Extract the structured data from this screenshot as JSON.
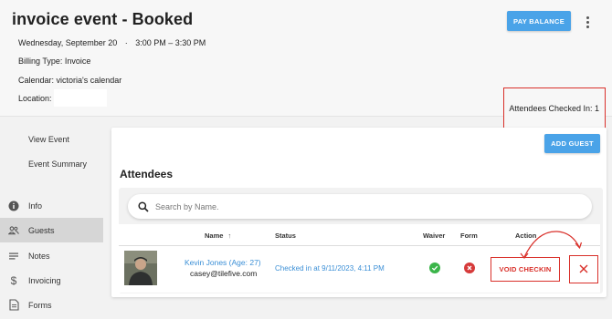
{
  "header": {
    "title": "invoice event - Booked",
    "date": "Wednesday, September 20",
    "separator": "·",
    "time": "3:00 PM – 3:30 PM",
    "billing": "Billing Type: Invoice",
    "calendar": "Calendar: victoria's calendar",
    "location": "Location:",
    "pay_balance": "PAY BALANCE",
    "checked_in": "Attendees Checked In: 1"
  },
  "sidebar": {
    "items": [
      {
        "label": "View Event"
      },
      {
        "label": "Event Summary"
      },
      {
        "label": "Info",
        "icon": "info-icon"
      },
      {
        "label": "Guests",
        "icon": "people-icon",
        "active": true
      },
      {
        "label": "Notes",
        "icon": "notes-icon"
      },
      {
        "label": "Invoicing",
        "icon": "dollar-icon"
      },
      {
        "label": "Forms",
        "icon": "document-icon"
      }
    ]
  },
  "main": {
    "add_guest": "ADD GUEST",
    "attendees_heading": "Attendees",
    "search_placeholder": "Search by Name.",
    "columns": {
      "name": "Name",
      "sort_arrow": "↑",
      "status": "Status",
      "waiver": "Waiver",
      "form": "Form",
      "action": "Action"
    },
    "rows": [
      {
        "name": "Kevin Jones (Age: 27)",
        "email": "casey@tilefive.com",
        "status": "Checked in at 9/11/2023, 4:11 PM",
        "waiver": "complete",
        "form": "incomplete",
        "void_label": "VOID CHECKIN"
      }
    ]
  },
  "colors": {
    "accent": "#4aa3e8",
    "link": "#3b8fd6",
    "highlight": "#d9302a",
    "success": "#3bb54a",
    "error": "#d63a3a"
  }
}
